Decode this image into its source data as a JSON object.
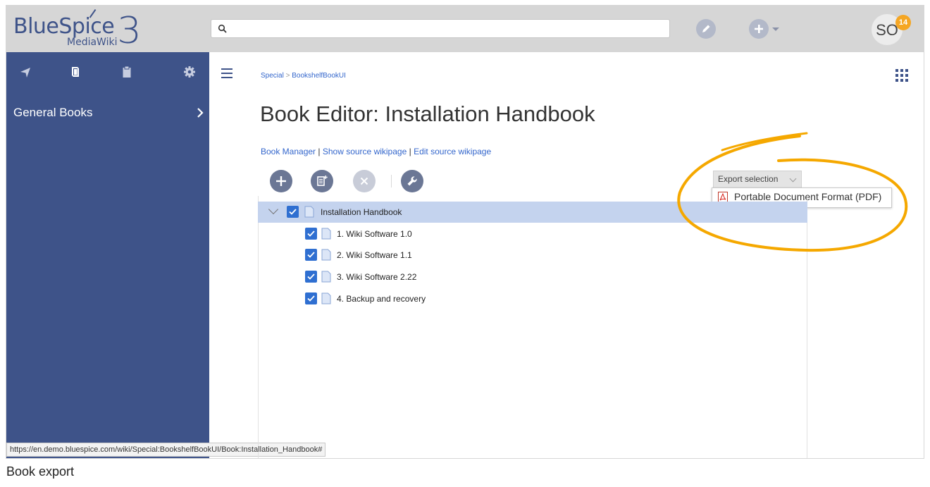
{
  "header": {
    "logo_text": "BlueSpice",
    "logo_sub": "MediaWiki",
    "logo_version": "3",
    "search_placeholder": "",
    "user_initials": "SO",
    "notification_count": "14"
  },
  "sidebar": {
    "tabs": [
      {
        "name": "navigation-icon"
      },
      {
        "name": "book-icon"
      },
      {
        "name": "clipboard-icon"
      },
      {
        "name": "gear-icon"
      }
    ],
    "items": [
      {
        "label": "General Books"
      }
    ],
    "color": "#3e5389"
  },
  "status_url": "https://en.demo.bluespice.com/wiki/Special:BookshelfBookUI/Book:Installation_Handbook#",
  "breadcrumb": {
    "first": "Special",
    "separator": ">",
    "second": "BookshelfBookUI"
  },
  "page": {
    "title": "Book Editor: Installation Handbook",
    "links": [
      {
        "label": "Book Manager"
      },
      {
        "label": "Show source wikipage"
      },
      {
        "label": "Edit source wikipage"
      }
    ],
    "link_separator": "|"
  },
  "toolbar": {
    "buttons": [
      {
        "name": "add",
        "icon": "plus-icon",
        "enabled": true
      },
      {
        "name": "add-mass",
        "icon": "add-pages-icon",
        "enabled": true
      },
      {
        "name": "remove",
        "icon": "close-icon",
        "enabled": false
      },
      {
        "name": "tools",
        "icon": "wrench-icon",
        "enabled": true
      }
    ],
    "export_label": "Export selection",
    "export_options": [
      {
        "label": "Portable Document Format (PDF)",
        "icon": "pdf-icon"
      }
    ]
  },
  "tree": {
    "root": {
      "label": "Installation Handbook",
      "checked": true,
      "expanded": true
    },
    "children": [
      {
        "label": "1. Wiki Software 1.0",
        "checked": true
      },
      {
        "label": "2. Wiki Software 1.1",
        "checked": true
      },
      {
        "label": "3. Wiki Software 2.22",
        "checked": true
      },
      {
        "label": "4. Backup and recovery",
        "checked": true
      }
    ]
  },
  "caption": "Book export",
  "colors": {
    "accent": "#3e5389",
    "checkbox": "#2f6fd1",
    "selected_row": "#c4d3ee",
    "highlight": "#f5a800",
    "badge": "#f5a623"
  }
}
